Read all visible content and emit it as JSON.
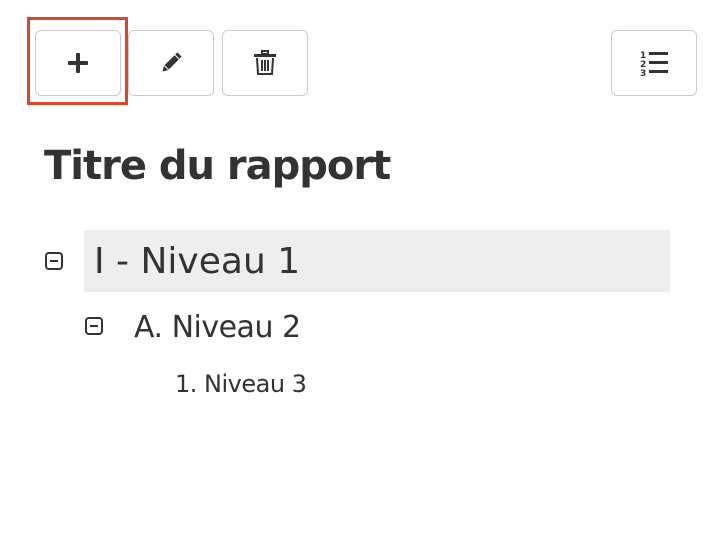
{
  "toolbar": {
    "buttons": [
      {
        "icon": "plus-icon",
        "state": "highlighted"
      },
      {
        "icon": "pencil-icon"
      },
      {
        "icon": "trash-icon"
      },
      {
        "icon": "numbered-list-icon"
      }
    ],
    "numbered_list_digits": [
      "1",
      "2",
      "3"
    ],
    "highlight_color": "#d9482b"
  },
  "report": {
    "title": "Titre du rapport"
  },
  "outline": {
    "level1": {
      "label": "I - Niveau 1",
      "expanded": true
    },
    "level2": {
      "label": "A. Niveau 2",
      "expanded": true
    },
    "level3": {
      "label": "1. Niveau 3"
    }
  },
  "colors": {
    "text": "#333333",
    "selected_row_bg": "#eeeeee",
    "button_border": "#cccccc"
  }
}
